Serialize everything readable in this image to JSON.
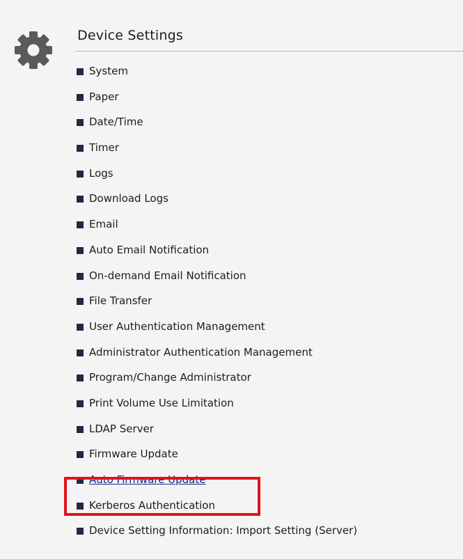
{
  "header": {
    "title": "Device Settings",
    "icon": "gear-icon"
  },
  "menu": {
    "items": [
      {
        "label": "System"
      },
      {
        "label": "Paper"
      },
      {
        "label": "Date/Time"
      },
      {
        "label": "Timer"
      },
      {
        "label": "Logs"
      },
      {
        "label": "Download Logs"
      },
      {
        "label": "Email"
      },
      {
        "label": "Auto Email Notification"
      },
      {
        "label": "On-demand Email Notification"
      },
      {
        "label": "File Transfer"
      },
      {
        "label": "User Authentication Management"
      },
      {
        "label": "Administrator Authentication Management"
      },
      {
        "label": "Program/Change Administrator"
      },
      {
        "label": "Print Volume Use Limitation"
      },
      {
        "label": "LDAP Server"
      },
      {
        "label": "Firmware Update"
      },
      {
        "label": "Auto Firmware Update"
      },
      {
        "label": "Kerberos Authentication"
      },
      {
        "label": "Device Setting Information: Import Setting (Server)"
      }
    ]
  },
  "highlight": {
    "color": "#e0141b",
    "target": "Auto Firmware Update"
  },
  "colors": {
    "bullet": "#1f2a44",
    "text": "#1c1c1c",
    "link_underlined": "#16258a",
    "icon": "#5a5a5a"
  }
}
